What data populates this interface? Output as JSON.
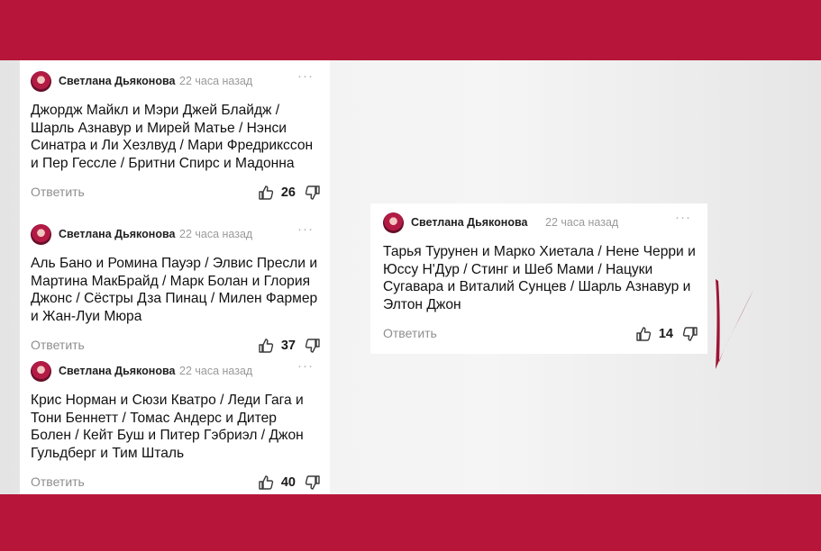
{
  "comments": [
    {
      "author": "Светлана Дьяконова",
      "time": "22 часа назад",
      "text": "Джордж Майкл и Мэри Джей Блайдж / Шарль Азнавур и Мирей Матье / Нэнси Синатра и Ли Хезлвуд / Мари Фредрикссон и Пер Гессле / Бритни Спирс и Мадонна",
      "reply": "Ответить",
      "likes": "26"
    },
    {
      "author": "Светлана Дьяконова",
      "time": "22 часа назад",
      "text": "Аль Бано и Ромина Пауэр / Элвис Пресли и Мартина МакБрайд / Марк Болан и Глория Джонс / Сёстры Дза Пинац / Милен Фармер и Жан-Луи Мюра",
      "reply": "Ответить",
      "likes": "37"
    },
    {
      "author": "Светлана Дьяконова",
      "time": "22 часа назад",
      "text": "Крис Норман и Сюзи Кватро / Леди Гага и Тони Беннетт / Томас Андерс и Дитер Болен / Кейт Буш и Питер Гэбриэл / Джон Гульдберг и Тим Шталь",
      "reply": "Ответить",
      "likes": "40"
    },
    {
      "author": "Светлана Дьяконова",
      "time": "22 часа назад",
      "text": "Тарья Турунен и Марко Хиетала / Нене Черри и Юссу Н'Дур / Стинг и Шеб Мами / Нацуки Сугавара и Виталий Сунцев / Шарль Азнавур и Элтон Джон",
      "reply": "Ответить",
      "likes": "14"
    }
  ],
  "colors": {
    "band": "#b7163a",
    "checkmark": "#9c1433"
  },
  "icons": {
    "more": "more-dots-icon",
    "like": "thumbs-up-icon",
    "dislike": "thumbs-down-icon",
    "avatar": "avatar",
    "mark": "checkmark-icon"
  }
}
